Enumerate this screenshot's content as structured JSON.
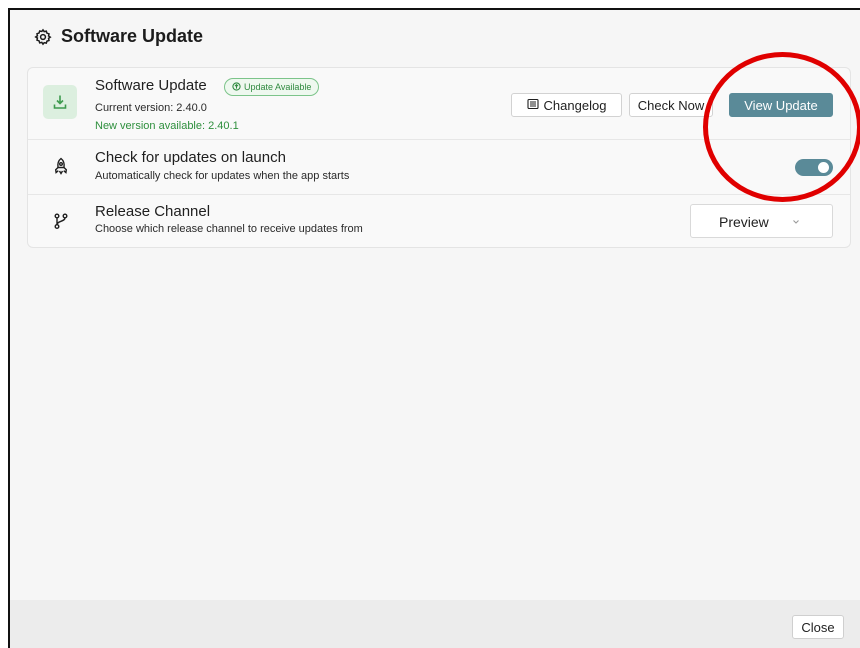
{
  "dialog": {
    "title": "Software Update",
    "title_icon": "gear-icon"
  },
  "update_row": {
    "icon": "download-icon",
    "title": "Software Update",
    "badge": "Update Available",
    "badge_icon": "circle-arrow-up-icon",
    "current_version": "Current version: 2.40.0",
    "new_version": "New version available: 2.40.1",
    "changelog_label": "Changelog",
    "changelog_icon": "document-list-icon",
    "check_now_label": "Check Now",
    "view_update_label": "View Update"
  },
  "launch_row": {
    "icon": "rocket-icon",
    "title": "Check for updates on launch",
    "subtitle": "Automatically check for updates when the app starts",
    "toggle_on": true
  },
  "channel_row": {
    "icon": "git-branch-icon",
    "title": "Release Channel",
    "subtitle": "Choose which release channel to receive updates from",
    "selected": "Preview"
  },
  "footer": {
    "close_label": "Close"
  },
  "colors": {
    "accent": "#5a8a98",
    "success": "#2e8f3d",
    "annotation": "#e00000"
  }
}
